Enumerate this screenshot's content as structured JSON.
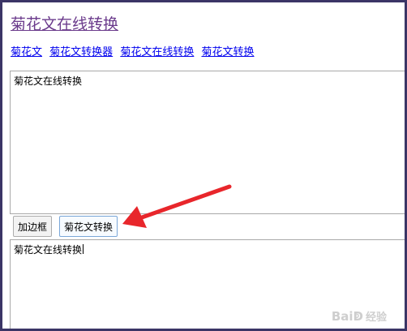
{
  "page": {
    "title": "菊花文在线转换"
  },
  "nav": {
    "links": [
      "菊花文",
      "菊花文转换器",
      "菊花文在线转换",
      "菊花文转换"
    ]
  },
  "input": {
    "value": "菊花文在线转换"
  },
  "buttons": {
    "add_border": "加边框",
    "convert": "菊花文转换"
  },
  "output": {
    "value": "菊花文在线转换"
  },
  "watermark": {
    "brand": "Bai",
    "paw": "ↁ",
    "brand_suffix": "经验"
  },
  "annotation": {
    "arrow_color": "#e8262b"
  }
}
